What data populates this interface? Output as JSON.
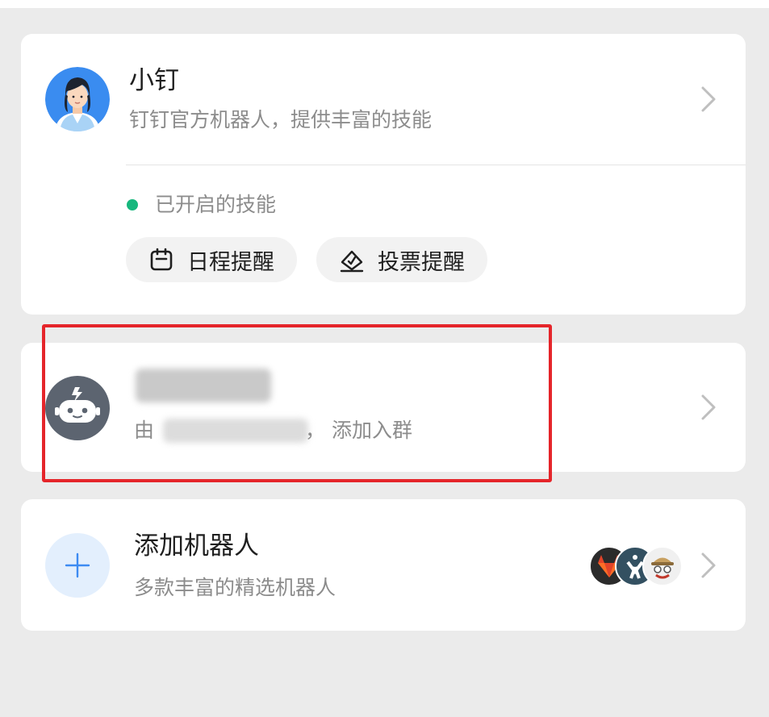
{
  "assistant": {
    "name": "小钉",
    "description": "钉钉官方机器人，提供丰富的技能",
    "skills_header": "已开启的技能",
    "skills": [
      {
        "label": "日程提醒",
        "icon": "calendar-icon"
      },
      {
        "label": "投票提醒",
        "icon": "vote-icon"
      }
    ]
  },
  "group_bot": {
    "name": "",
    "added_prefix": "由",
    "added_suffix": "， 添加入群",
    "icon": "robot-icon"
  },
  "add_bot": {
    "title": "添加机器人",
    "subtitle": "多款丰富的精选机器人",
    "icon": "plus-icon",
    "previews": [
      "gitlab-icon",
      "jenkins-icon",
      "travis-icon"
    ]
  },
  "colors": {
    "background": "#ebebeb",
    "card": "#ffffff",
    "active_dot": "#17b77d",
    "highlight_border": "#e5252a",
    "plus_accent": "#3d8bf2"
  }
}
